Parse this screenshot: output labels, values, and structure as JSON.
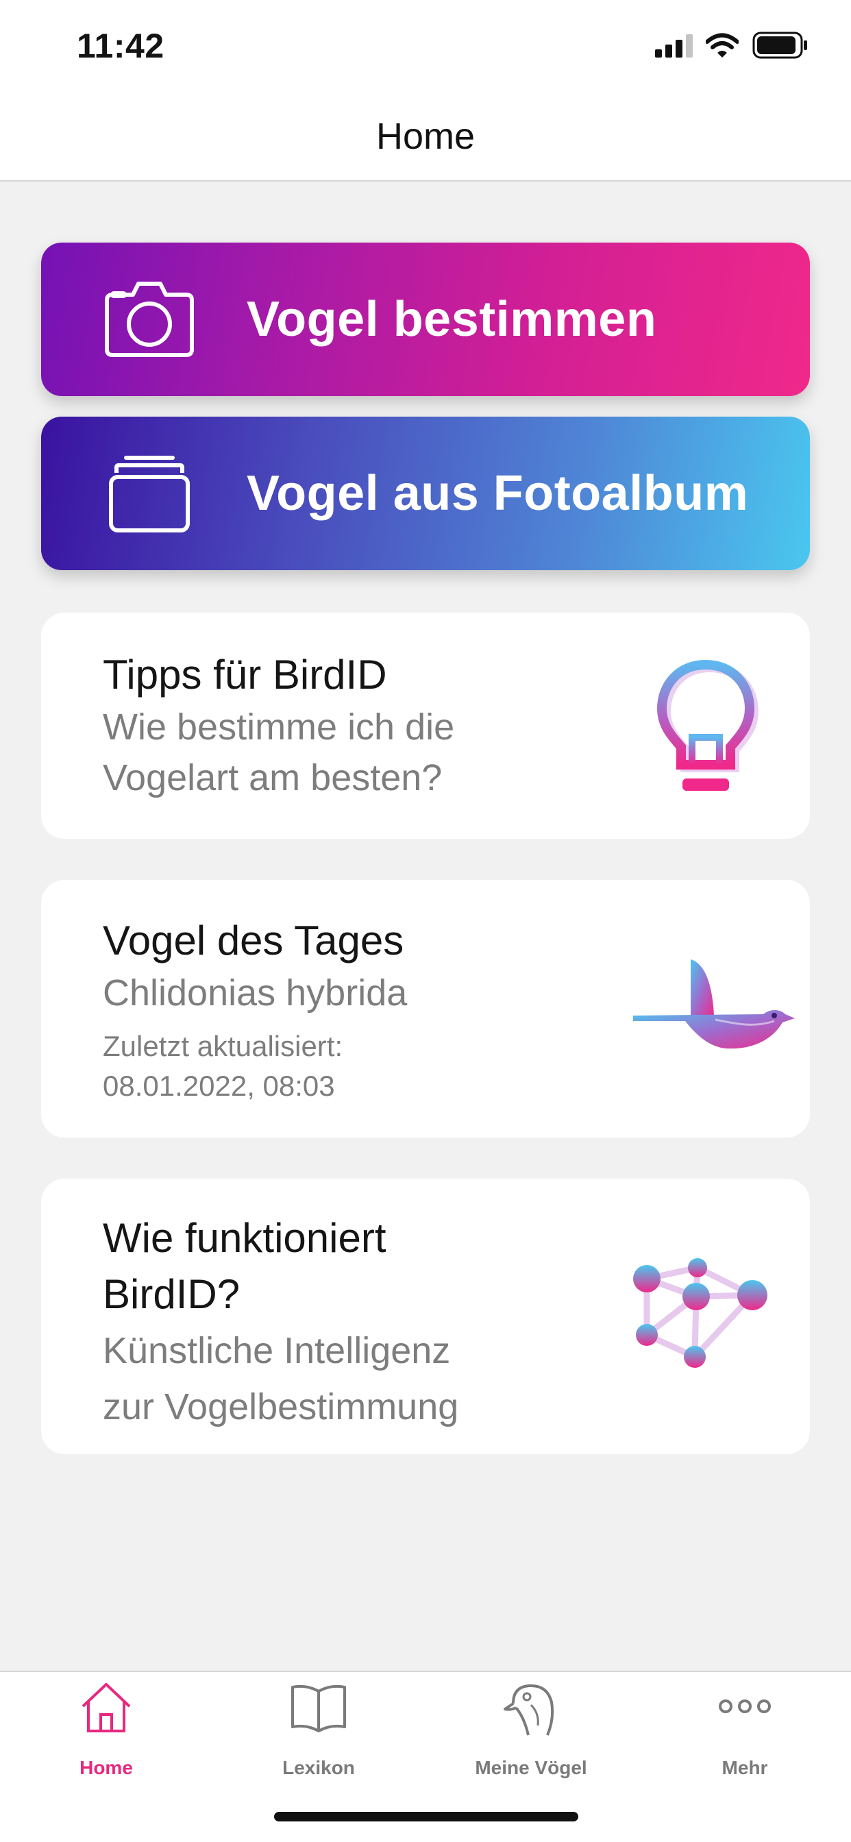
{
  "status_bar": {
    "time": "11:42"
  },
  "nav": {
    "title": "Home"
  },
  "actions": {
    "identify_label": "Vogel bestimmen",
    "album_label": "Vogel aus Fotoalbum"
  },
  "cards": {
    "tips": {
      "title": "Tipps für BirdID",
      "subtitle": "Wie bestimme ich die Vogelart am besten?"
    },
    "bird_of_day": {
      "title": "Vogel des Tages",
      "species": "Chlidonias hybrida",
      "updated_label": "Zuletzt aktualisiert:",
      "updated_value": "08.01.2022, 08:03"
    },
    "how_it_works": {
      "title": "Wie funktioniert BirdID?",
      "subtitle": "Künstliche Intelligenz zur Vogelbestimmung"
    }
  },
  "tabs": [
    {
      "label": "Home",
      "icon": "house-icon",
      "active": true
    },
    {
      "label": "Lexikon",
      "icon": "book-icon",
      "active": false
    },
    {
      "label": "Meine Vögel",
      "icon": "bird-head-icon",
      "active": false
    },
    {
      "label": "Mehr",
      "icon": "more-dots-icon",
      "active": false
    }
  ],
  "colors": {
    "accent": "#e8287f",
    "inactive_tab": "#7a7a7a"
  }
}
